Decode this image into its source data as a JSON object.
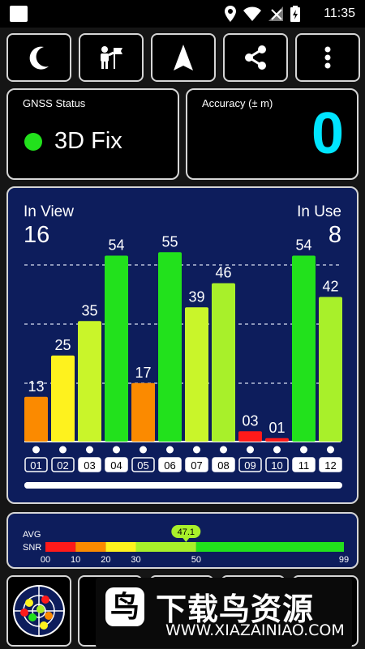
{
  "status_bar": {
    "time": "11:35"
  },
  "toolbar": {
    "buttons": [
      "moon-icon",
      "person-flag-icon",
      "navigation-arrow-icon",
      "share-icon",
      "more-vert-icon"
    ]
  },
  "gnss_status": {
    "label": "GNSS Status",
    "value": "3D Fix",
    "indicator_color": "#22e11c"
  },
  "accuracy": {
    "label": "Accuracy (± m)",
    "value": "0",
    "value_color": "#00e5ff"
  },
  "satellites": {
    "in_view_label": "In View",
    "in_view": "16",
    "in_use_label": "In Use",
    "in_use": "8",
    "list_scroll_fraction": 0.75
  },
  "chart_data": {
    "type": "bar",
    "categories": [
      "01",
      "02",
      "03",
      "04",
      "05",
      "06",
      "07",
      "08",
      "09",
      "10",
      "11",
      "12"
    ],
    "values": [
      13,
      25,
      35,
      54,
      17,
      55,
      39,
      46,
      3,
      1,
      54,
      42
    ],
    "value_labels": [
      "13",
      "25",
      "35",
      "54",
      "17",
      "55",
      "39",
      "46",
      "03",
      "01",
      "54",
      "42"
    ],
    "in_use": [
      false,
      false,
      true,
      true,
      false,
      true,
      true,
      true,
      false,
      false,
      true,
      true
    ],
    "ylim": [
      0,
      60
    ],
    "colors": [
      "#fb8a00",
      "#fef21e",
      "#c9f52a",
      "#22e11c",
      "#fb8a00",
      "#22e11c",
      "#c9f52a",
      "#a8f02a",
      "#ff1a1a",
      "#ff1a1a",
      "#22e11c",
      "#a8f02a"
    ]
  },
  "snr": {
    "title_line1": "AVG",
    "title_line2": "SNR",
    "avg_value": "47.1",
    "avg_fraction": 0.471,
    "max_tick": 99,
    "ticks": [
      "00",
      "10",
      "20",
      "30",
      "50",
      "99"
    ],
    "ticks_values": [
      0,
      10,
      20,
      30,
      50,
      99
    ],
    "segments": [
      {
        "from": 0,
        "to": 10,
        "color": "#ff1a1a"
      },
      {
        "from": 10,
        "to": 20,
        "color": "#fb8a00"
      },
      {
        "from": 20,
        "to": 30,
        "color": "#fef21e"
      },
      {
        "from": 30,
        "to": 50,
        "color": "#a8f02a"
      },
      {
        "from": 50,
        "to": 99,
        "color": "#22e11c"
      }
    ]
  },
  "watermark": {
    "logo": "鸟",
    "title": "下载鸟资源",
    "url": "WWW.XIAZAINIAO.COM"
  }
}
